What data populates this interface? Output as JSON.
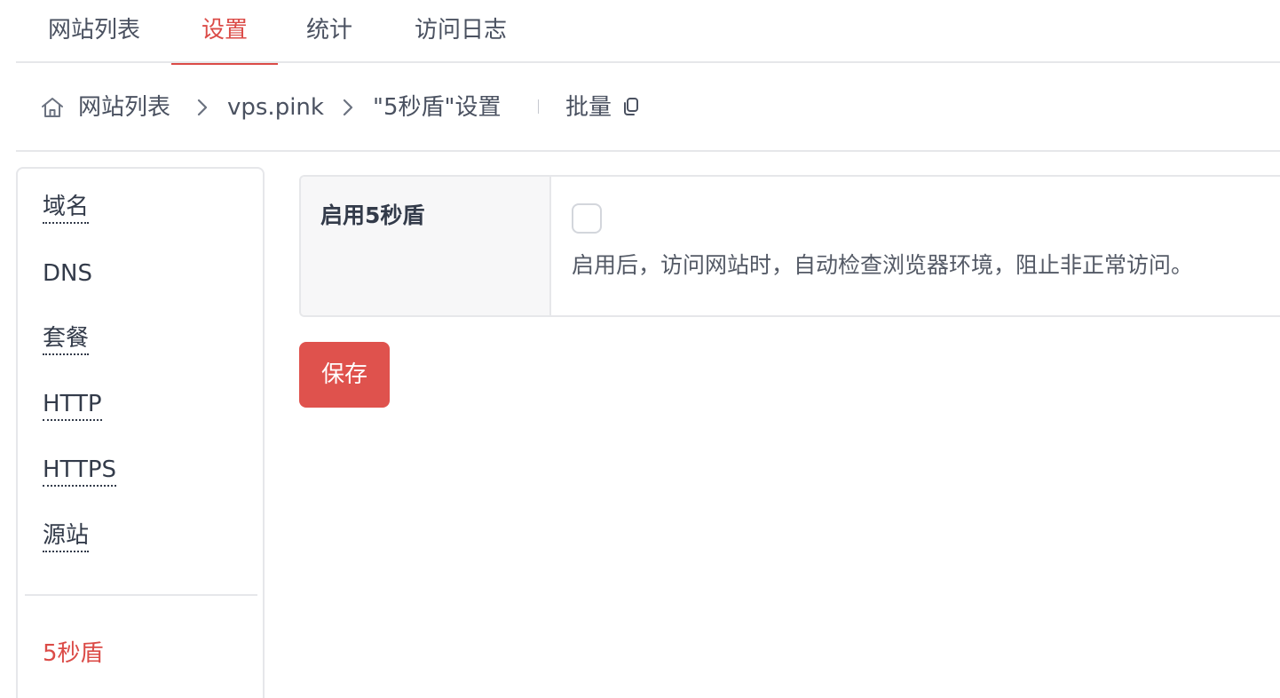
{
  "tabs": [
    {
      "label": "网站列表",
      "active": false
    },
    {
      "label": "设置",
      "active": true
    },
    {
      "label": "统计",
      "active": false
    },
    {
      "label": "访问日志",
      "active": false
    }
  ],
  "breadcrumb": {
    "home_icon": "home-icon",
    "items": [
      "网站列表",
      "vps.pink",
      "\"5秒盾\"设置"
    ],
    "batch_label": "批量",
    "batch_icon": "copy-icon"
  },
  "side_menu": {
    "items": [
      {
        "label": "域名",
        "dotted": true,
        "active": false
      },
      {
        "label": "DNS",
        "dotted": false,
        "active": false
      },
      {
        "label": "套餐",
        "dotted": true,
        "active": false
      },
      {
        "label": "HTTP",
        "dotted": true,
        "active": false
      },
      {
        "label": "HTTPS",
        "dotted": true,
        "active": false
      },
      {
        "label": "源站",
        "dotted": true,
        "active": false
      }
    ],
    "bottom_items": [
      {
        "label": "5秒盾",
        "active": true
      }
    ]
  },
  "settings": {
    "enable_label": "启用5秒盾",
    "enabled": false,
    "help": "启用后，访问网站时，自动检查浏览器环境，阻止非正常访问。"
  },
  "save_label": "保存",
  "colors": {
    "accent": "#db4b47",
    "button": "#df524d",
    "border": "#e6e7ea",
    "label_bg": "#f7f7f8"
  }
}
